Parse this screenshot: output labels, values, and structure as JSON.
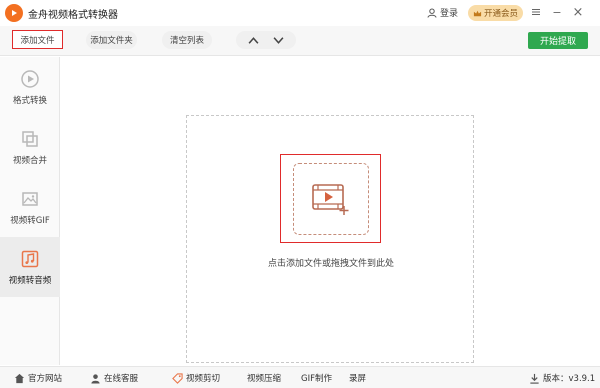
{
  "app": {
    "title": "金舟视频格式转换器",
    "brand_color": "#f37021"
  },
  "header": {
    "login_label": "登录",
    "vip_label": "开通会员",
    "minimize": "−",
    "close": "×"
  },
  "toolbar": {
    "add_file": "添加文件",
    "add_folder": "添加文件夹",
    "clear_list": "清空列表",
    "move_up": "∧",
    "move_down": "∨",
    "start": "开始提取",
    "start_color": "#2fa84f"
  },
  "sidebar": {
    "items": [
      {
        "label": "格式转换",
        "icon": "play-circle-icon"
      },
      {
        "label": "视频合并",
        "icon": "merge-icon"
      },
      {
        "label": "视频转GIF",
        "icon": "image-icon"
      },
      {
        "label": "视频转音频",
        "icon": "music-note-icon",
        "active": true
      }
    ]
  },
  "main": {
    "drop_hint": "点击添加文件或拖拽文件到此处"
  },
  "statusbar": {
    "website": "官方网站",
    "support": "在线客服",
    "video_cut": "视频剪切",
    "video_compress": "视频压缩",
    "gif_make": "GIF制作",
    "record": "录屏",
    "version": "版本：v3.9.1"
  }
}
